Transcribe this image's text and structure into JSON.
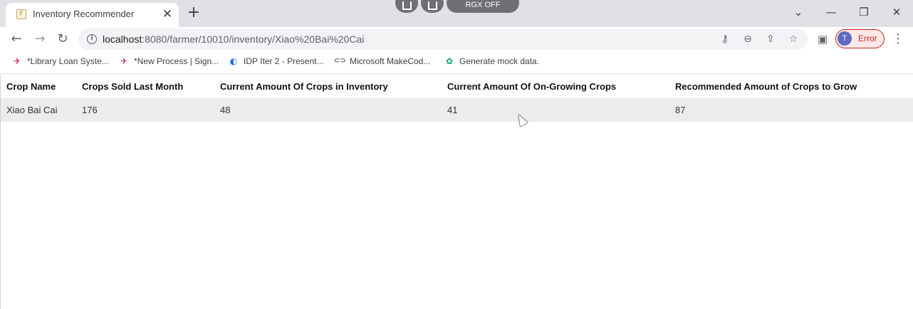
{
  "browser": {
    "tab": {
      "favicon_letter": "F",
      "title": "Inventory Recommender",
      "close_glyph": "✕"
    },
    "new_tab_glyph": "+",
    "overlay": {
      "pill_label": "RGX OFF"
    },
    "window_controls": {
      "chevron": "⌄",
      "minimize": "—",
      "restore": "❐",
      "close": "✕"
    },
    "nav": {
      "back": "←",
      "forward": "→",
      "reload": "↻"
    },
    "address": {
      "host": "localhost",
      "path": ":8080/farmer/10010/inventory/Xiao%20Bai%20Cai"
    },
    "omnibox_icons": {
      "key": "⚷",
      "zoom": "⊖",
      "share": "⇪",
      "star": "☆"
    },
    "side_panel_icon": "▣",
    "profile": {
      "initial": "T",
      "label": "Error"
    },
    "menu_glyph": "⋮",
    "bookmarks": [
      {
        "icon": "✈",
        "label": "*Library Loan Syste..."
      },
      {
        "icon": "✈",
        "label": "*New Process | Sign..."
      },
      {
        "icon": "◐",
        "label": "IDP Iter 2 - Present..."
      },
      {
        "icon": "⊂⊃",
        "label": "Microsoft MakeCod..."
      },
      {
        "icon": "✿",
        "label": "Generate mock data."
      }
    ]
  },
  "table": {
    "headers": [
      "Crop Name",
      "Crops Sold Last Month",
      "Current Amount Of Crops in Inventory",
      "Current Amount Of On-Growing Crops",
      "Recommended Amount of Crops to Grow"
    ],
    "rows": [
      [
        "Xiao Bai Cai",
        "176",
        "48",
        "41",
        "87"
      ]
    ]
  }
}
